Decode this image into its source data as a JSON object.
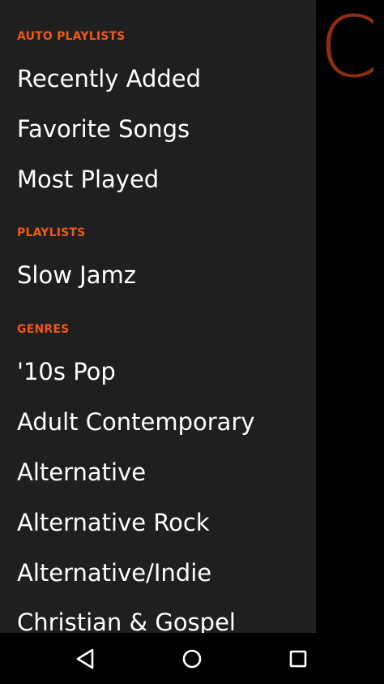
{
  "background": {
    "letter": "C",
    "accent_color": "#8a2e0e"
  },
  "drawer": {
    "header_color": "#f0581a",
    "auto_playlists": {
      "header": "AUTO PLAYLISTS",
      "items": [
        "Recently Added",
        "Favorite Songs",
        "Most Played"
      ]
    },
    "playlists": {
      "header": "PLAYLISTS",
      "items": [
        "Slow Jamz"
      ]
    },
    "genres": {
      "header": "GENRES",
      "items": [
        "'10s Pop",
        "Adult Contemporary",
        "Alternative",
        "Alternative Rock",
        "Alternative/Indie",
        "Christian & Gospel"
      ]
    }
  },
  "navbar": {
    "back_icon": "back-triangle-icon",
    "home_icon": "home-circle-icon",
    "recents_icon": "recents-square-icon"
  }
}
